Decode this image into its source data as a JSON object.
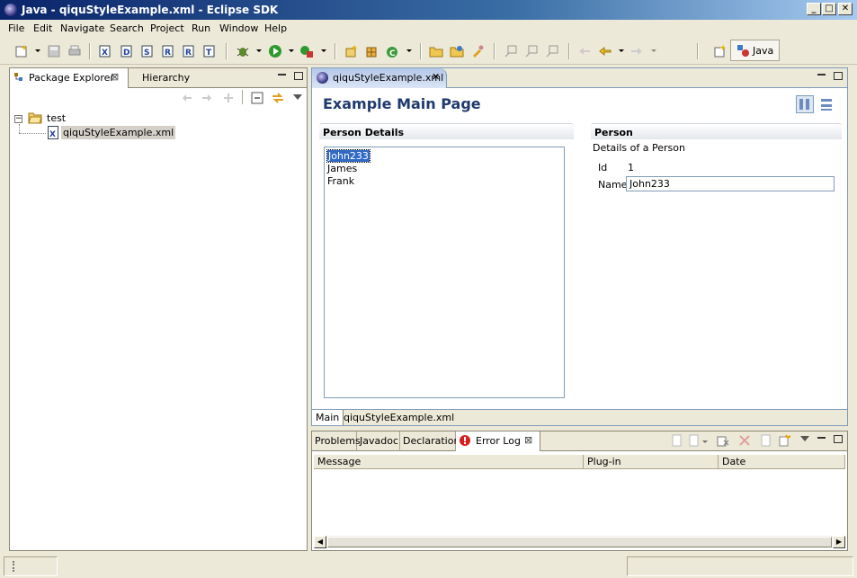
{
  "window": {
    "title": "Java - qiquStyleExample.xml - Eclipse SDK",
    "min": "_",
    "max": "□",
    "close": "✕"
  },
  "menu": [
    "File",
    "Edit",
    "Navigate",
    "Search",
    "Project",
    "Run",
    "Window",
    "Help"
  ],
  "perspective": {
    "label": "Java"
  },
  "package_explorer": {
    "tabs": [
      {
        "label": "Package Explorer"
      },
      {
        "label": "Hierarchy"
      }
    ],
    "tree": {
      "project": "test",
      "file": "qiquStyleExample.xml"
    }
  },
  "editor": {
    "tab": "qiquStyleExample.xml",
    "title": "Example Main Page",
    "left_section": {
      "header": "Person Details",
      "items": [
        "John233",
        "James",
        "Frank"
      ],
      "selected": 0
    },
    "right_section": {
      "header": "Person",
      "description": "Details of a Person",
      "id_label": "Id",
      "id_value": "1",
      "name_label": "Name",
      "name_value": "John233"
    },
    "bottom_tabs": [
      "Main",
      "qiquStyleExample.xml"
    ]
  },
  "bottom_panel": {
    "tabs": [
      "Problems",
      "Javadoc",
      "Declaration",
      "Error Log"
    ],
    "columns": [
      "Message",
      "Plug-in",
      "Date"
    ]
  },
  "colors": {
    "title_start": "#0a246a",
    "title_end": "#a6caf0",
    "form_title": "#1f3a6e",
    "selection": "#316ac5"
  }
}
